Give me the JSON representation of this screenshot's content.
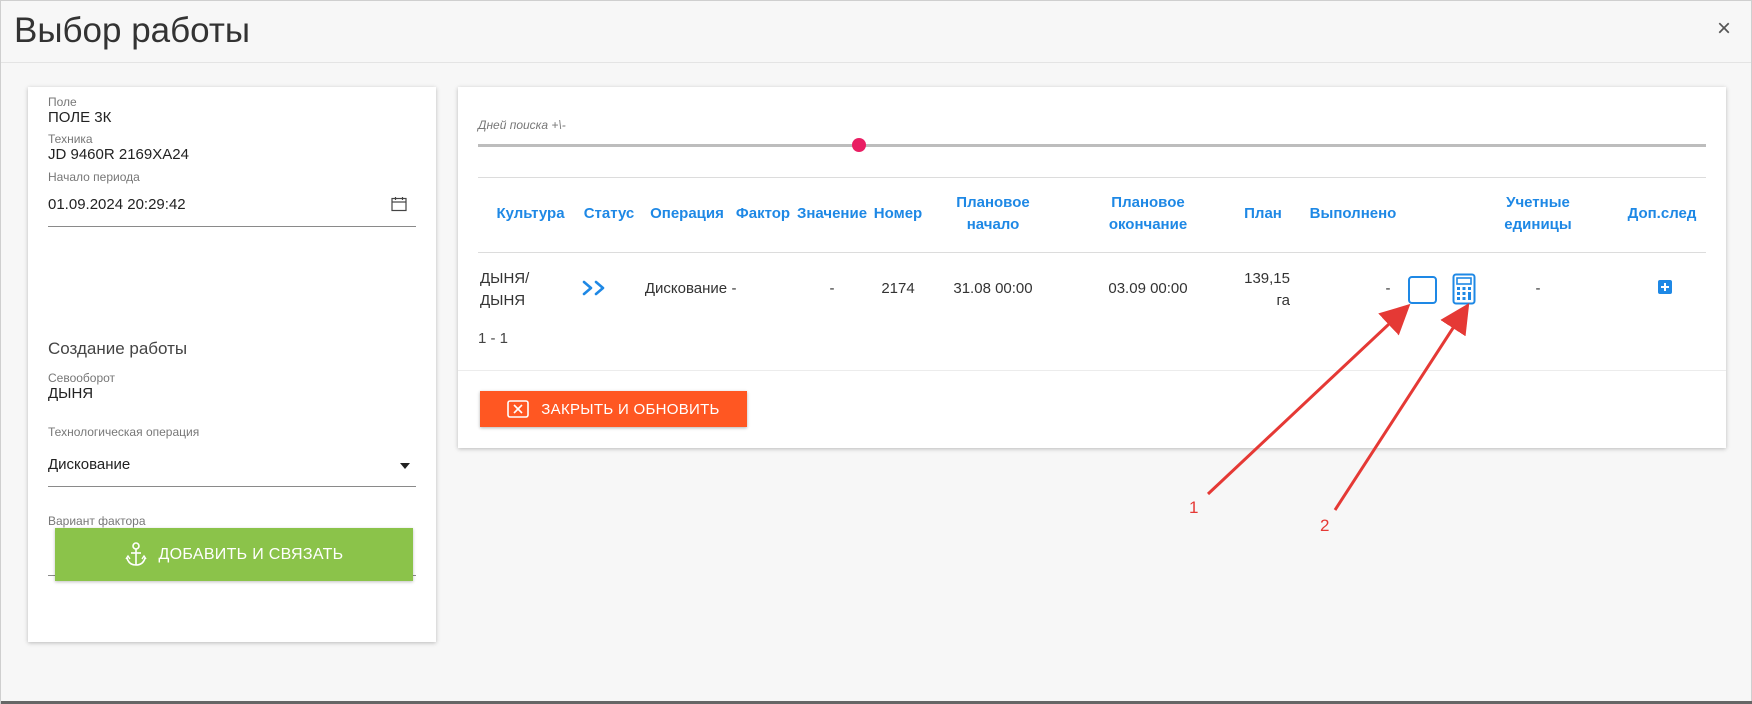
{
  "dialog": {
    "title": "Выбор работы",
    "close_label": "×"
  },
  "left": {
    "field_label": "Поле",
    "field_value": "ПОЛЕ 3К",
    "machine_label": "Техника",
    "machine_value": "JD 9460R 2169ХА24",
    "period_label": "Начало периода",
    "period_value": "01.09.2024 20:29:42",
    "create_title": "Создание работы",
    "rotation_label": "Севооборот",
    "rotation_value": "ДЫНЯ",
    "operation_label": "Технологическая операция",
    "operation_value": "Дискование",
    "factor_label": "Вариант фактора",
    "factor_value": "",
    "add_button": "ДОБАВИТЬ И СВЯЗАТЬ"
  },
  "right": {
    "slider_label": "Дней поиска +\\-",
    "slider_value": 0.31,
    "columns": {
      "culture": "Культура",
      "status": "Статус",
      "operation": "Операция",
      "factor": "Фактор",
      "value": "Значение",
      "number": "Номер",
      "plan_start_1": "Плановое",
      "plan_start_2": "начало",
      "plan_end_1": "Плановое",
      "plan_end_2": "окончание",
      "plan": "План",
      "done": "Выполнено",
      "units_1": "Учетные",
      "units_2": "единицы",
      "extra": "Доп.след"
    },
    "row": {
      "culture_1": "ДЫНЯ/",
      "culture_2": "ДЫНЯ",
      "operation": "Дискование",
      "factor": "-",
      "value": "-",
      "number": "2174",
      "plan_start": "31.08 00:00",
      "plan_end": "03.09 00:00",
      "plan_1": "139,15",
      "plan_2": "га",
      "done": "-",
      "units": "-"
    },
    "pager": "1 - 1",
    "close_button": "ЗАКРЫТЬ И ОБНОВИТЬ"
  },
  "annotations": {
    "one": "1",
    "two": "2"
  },
  "colors": {
    "accent_blue": "#1e88e5",
    "slider_pink": "#e91e63",
    "add_green": "#8bc34a",
    "close_orange": "#ff5722",
    "annotation_red": "#e53935"
  },
  "icons": [
    "close-icon",
    "calendar-icon",
    "dropdown-arrow-icon",
    "anchor-icon",
    "status-arrows-icon",
    "calculator-icon",
    "plus-square-icon",
    "close-box-icon"
  ]
}
